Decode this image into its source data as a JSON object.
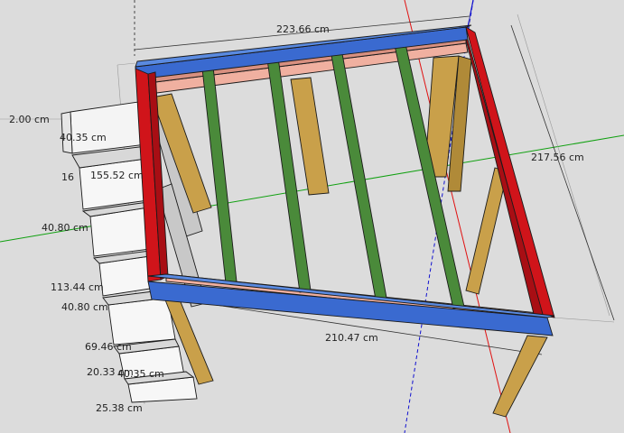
{
  "viewport": {
    "background": "#dcdcdc",
    "axis_colors": {
      "red": "#e01010",
      "green": "#10a010",
      "blue": "#1010d0"
    }
  },
  "materials": {
    "rim_red": "#d0141a",
    "beam_blue": "#3a6ad0",
    "joist_green": "#4a8a3a",
    "ledger_pink": "#f0b0a0",
    "post_tan": "#c9a04a",
    "stair_white": "#f4f4f4"
  },
  "dimensions": {
    "top_width": "223.66 cm",
    "right_depth": "217.56 cm",
    "bottom_width": "210.47 cm",
    "stair": [
      "2.00 cm",
      "40.35 cm",
      "16",
      "155.52 cm",
      "40.80 cm",
      "113.44 cm",
      "40.80 cm",
      "69.46 cm",
      "20.33 cm",
      "40.35 cm",
      "25.38 cm"
    ]
  }
}
